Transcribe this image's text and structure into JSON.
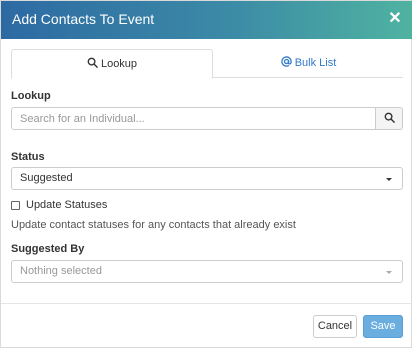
{
  "modal": {
    "title": "Add Contacts To Event",
    "close_glyph": "✕"
  },
  "tabs": [
    {
      "label": "Lookup",
      "icon": "search-icon",
      "active": true
    },
    {
      "label": "Bulk List",
      "icon": "at-icon",
      "active": false
    }
  ],
  "lookup": {
    "label": "Lookup",
    "placeholder": "Search for an Individual..."
  },
  "status": {
    "label": "Status",
    "selected": "Suggested"
  },
  "update_statuses": {
    "label": "Update Statuses",
    "checked": false,
    "help": "Update contact statuses for any contacts that already exist"
  },
  "suggested_by": {
    "label": "Suggested By",
    "selected": "Nothing selected"
  },
  "footer": {
    "cancel_label": "Cancel",
    "save_label": "Save"
  },
  "colors": {
    "header_gradient_start": "#2d6aa3",
    "header_gradient_end": "#4fb3a1",
    "link": "#2f79c8",
    "save_button": "#6aaee0"
  }
}
